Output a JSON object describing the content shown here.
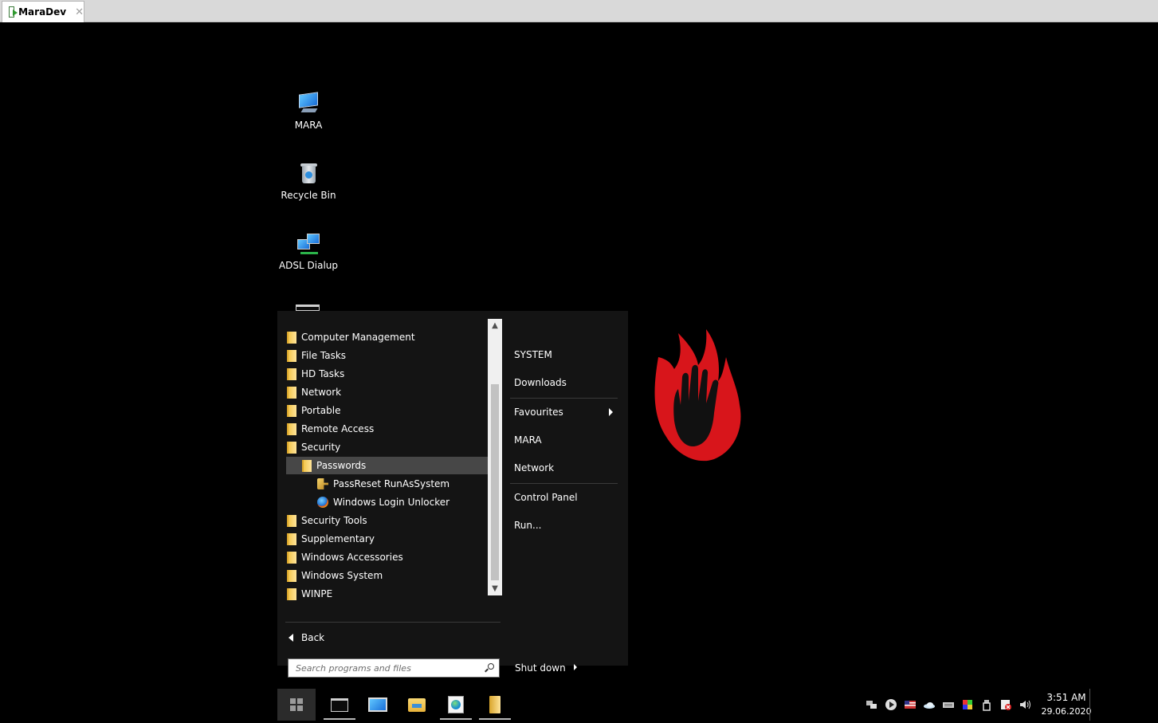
{
  "host": {
    "tab_title": "MaraDev",
    "close_glyph": "✕"
  },
  "desktop": {
    "icons": [
      {
        "label": "MARA",
        "icon": "computer-icon"
      },
      {
        "label": "Recycle Bin",
        "icon": "recycle-bin-icon"
      },
      {
        "label": "ADSL Dialup",
        "icon": "network-connection-icon"
      }
    ]
  },
  "start_menu": {
    "programs": [
      {
        "label": "Computer Management",
        "type": "folder"
      },
      {
        "label": "File Tasks",
        "type": "folder"
      },
      {
        "label": "HD Tasks",
        "type": "folder"
      },
      {
        "label": "Network",
        "type": "folder"
      },
      {
        "label": "Portable",
        "type": "folder"
      },
      {
        "label": "Remote Access",
        "type": "folder"
      },
      {
        "label": "Security",
        "type": "folder"
      },
      {
        "label": "Passwords",
        "type": "folder",
        "selected": true
      },
      {
        "label": "PassReset RunAsSystem",
        "type": "app",
        "icon": "key-icon"
      },
      {
        "label": "Windows Login Unlocker",
        "type": "app",
        "icon": "orb-icon"
      },
      {
        "label": "Security Tools",
        "type": "folder"
      },
      {
        "label": "Supplementary",
        "type": "folder"
      },
      {
        "label": "Windows Accessories",
        "type": "folder"
      },
      {
        "label": "Windows System",
        "type": "folder"
      },
      {
        "label": "WINPE",
        "type": "folder"
      }
    ],
    "back_label": "Back",
    "search_placeholder": "Search programs and files",
    "right_pane": {
      "items": [
        {
          "label": "SYSTEM"
        },
        {
          "label": "Downloads"
        },
        {
          "label": "Favourites",
          "has_submenu": true
        },
        {
          "label": "MARA"
        },
        {
          "label": "Network"
        },
        {
          "label": "Control Panel"
        },
        {
          "label": "Run..."
        }
      ],
      "shutdown_label": "Shut down"
    }
  },
  "taskbar": {
    "apps": [
      {
        "name": "command-prompt",
        "running": true
      },
      {
        "name": "remote-desktop",
        "running": false
      },
      {
        "name": "file-explorer",
        "running": false
      },
      {
        "name": "browser",
        "running": true
      },
      {
        "name": "folder",
        "running": true
      }
    ],
    "tray_icons": [
      "network-icon",
      "media-play-icon",
      "us-flag-icon",
      "cloud-icon",
      "keyboard-icon",
      "color-icon",
      "usb-drive-icon",
      "shield-icon",
      "volume-icon"
    ],
    "clock": {
      "time": "3:51 AM",
      "date": "29.06.2020"
    }
  },
  "colors": {
    "desktop_bg": "#000000",
    "menu_bg": "#141414",
    "selected_bg": "#474747",
    "logo_red": "#d8151b"
  }
}
